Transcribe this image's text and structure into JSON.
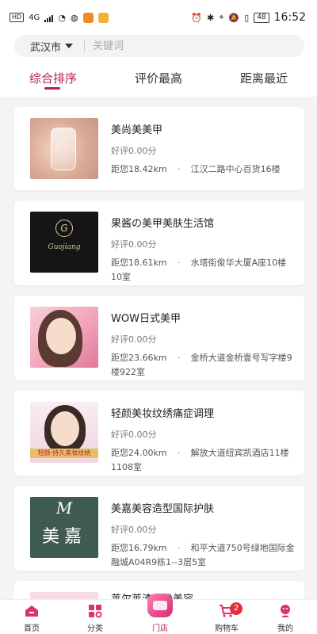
{
  "status_bar": {
    "network": "HD",
    "signal": "4G",
    "battery": "48",
    "time": "16:52"
  },
  "search": {
    "city": "武汉市",
    "placeholder": "关键词"
  },
  "tabs": [
    {
      "label": "综合排序",
      "active": true
    },
    {
      "label": "评价最高",
      "active": false
    },
    {
      "label": "距离最近",
      "active": false
    }
  ],
  "stores": [
    {
      "name": "美尚美美甲",
      "rating": "好评0.00分",
      "distance": "距您18.42km",
      "address": "江汉二路中心百货16楼"
    },
    {
      "name": "果酱の美甲美肤生活馆",
      "rating": "好评0.00分",
      "distance": "距您18.61km",
      "address": "水塔街俊华大厦A座10楼10室",
      "thumb_text": "Guojiang"
    },
    {
      "name": "WOW日式美甲",
      "rating": "好评0.00分",
      "distance": "距您23.66km",
      "address": "金桥大道金桥壹号写字楼9楼922室"
    },
    {
      "name": "轻颜美妆纹绣痛症调理",
      "rating": "好评0.00分",
      "distance": "距您24.00km",
      "address": "解放大道纽宾凯酒店11楼1108室",
      "thumb_text": "轻颜·持久美妆纹绣"
    },
    {
      "name": "美嘉美容造型国际护肤",
      "rating": "好评0.00分",
      "distance": "距您16.79km",
      "address": "和平大道750号绿地国际金融城A04R9栋1--3层5室",
      "thumb_text": "美嘉"
    },
    {
      "name": "莱尔莱渣米粉美容"
    }
  ],
  "tabbar": {
    "items": [
      {
        "label": "首页",
        "icon": "home-icon"
      },
      {
        "label": "分类",
        "icon": "grid-icon"
      },
      {
        "label": "门店",
        "icon": "store-icon",
        "active": true
      },
      {
        "label": "购物车",
        "icon": "cart-icon",
        "badge": "2"
      },
      {
        "label": "我的",
        "icon": "user-icon"
      }
    ]
  },
  "colors": {
    "accent": "#b0205a",
    "badge": "#e0303a"
  }
}
